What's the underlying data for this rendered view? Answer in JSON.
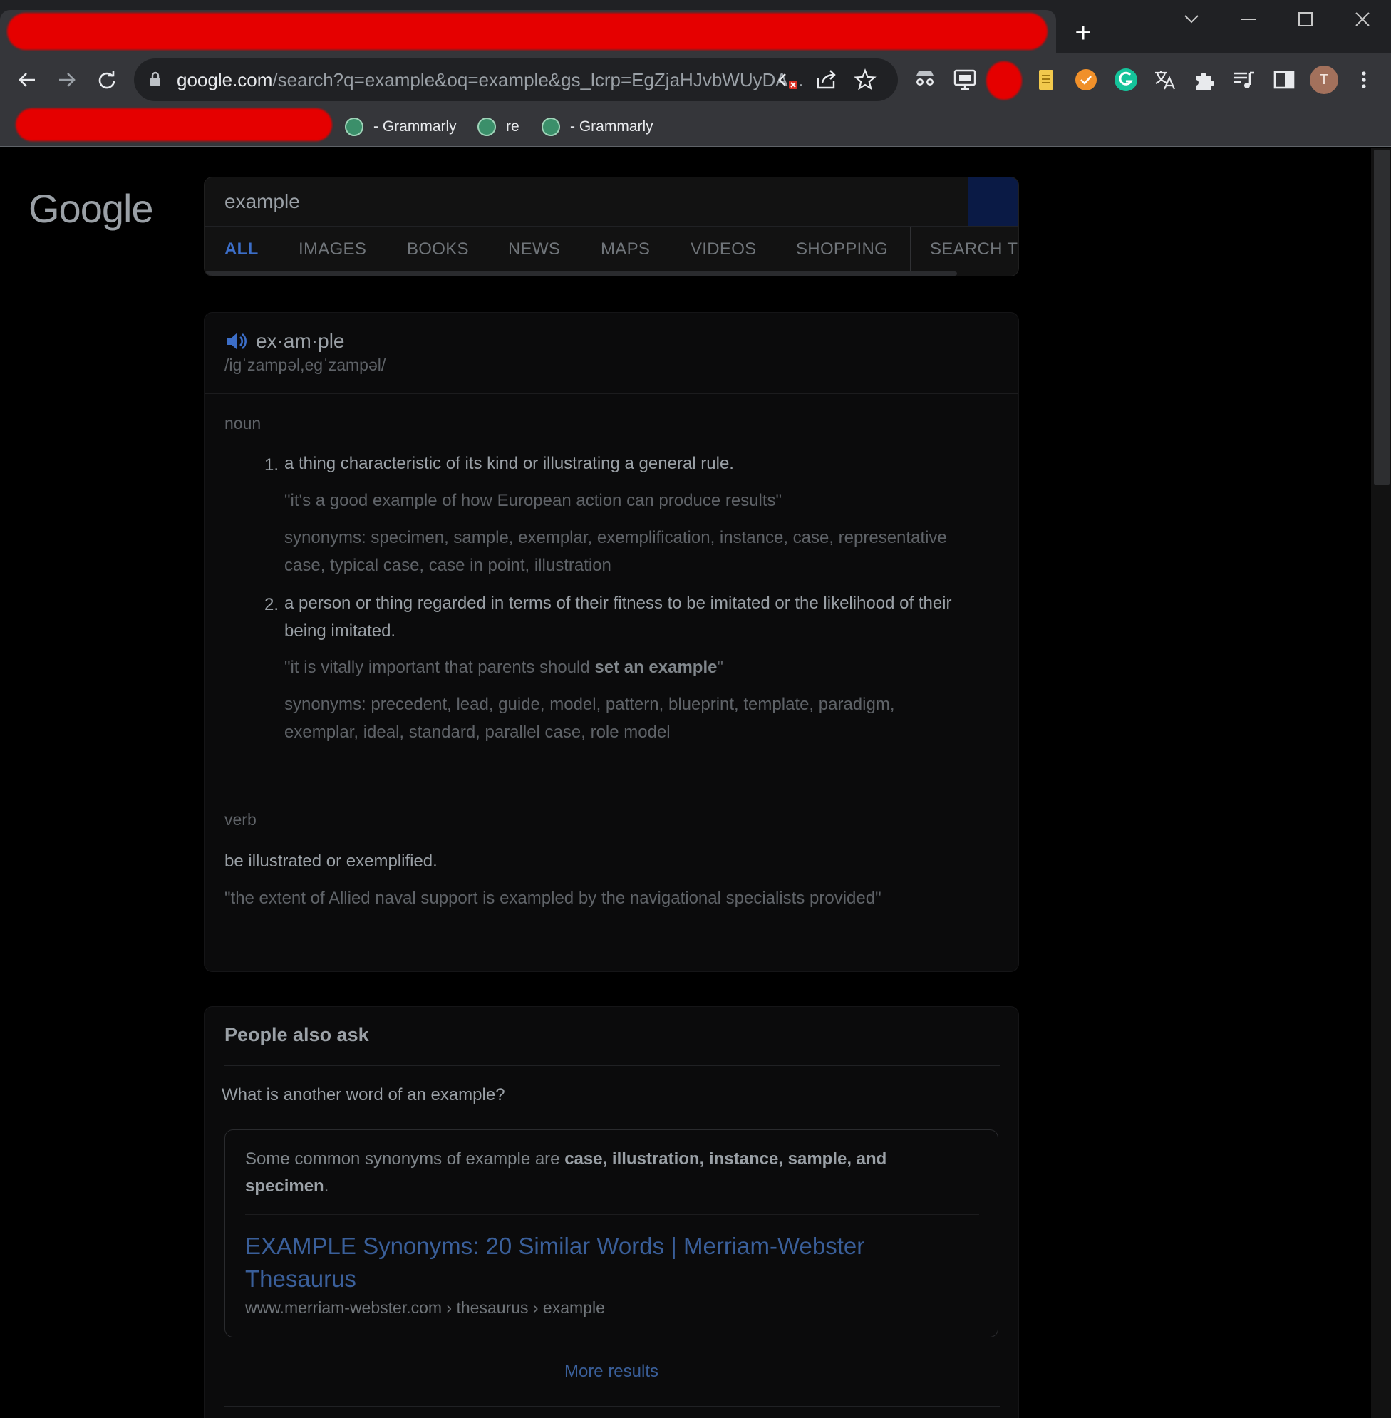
{
  "browser": {
    "new_tab_label": "+",
    "url_host": "google.com",
    "url_path": "/search?q=example&oq=example&gs_lcrp=EgZjaHJvbWUyDA...",
    "profile_initial": "T",
    "bookmarks": [
      {
        "label": "- Grammarly"
      },
      {
        "label": "re"
      },
      {
        "label": "- Grammarly"
      }
    ]
  },
  "google": {
    "logo_text": "Google",
    "query": "example",
    "tabs": [
      "ALL",
      "IMAGES",
      "BOOKS",
      "NEWS",
      "MAPS",
      "VIDEOS",
      "SHOPPING",
      "SEARCH T"
    ]
  },
  "dictionary": {
    "word": "ex·am·ple",
    "phonetic": "/iɡˈzampəl,eɡˈzampəl/",
    "noun_label": "noun",
    "defs": [
      {
        "num": "1.",
        "text": "a thing characteristic of its kind or illustrating a general rule.",
        "example": "\"it's a good example of how European action can produce results\"",
        "synonyms": "synonyms: specimen, sample, exemplar, exemplification, instance, case, representative case, typical case, case in point, illustration"
      },
      {
        "num": "2.",
        "text": "a person or thing regarded in terms of their fitness to be imitated or the likelihood of their being imitated.",
        "example_pre": "\"it is vitally important that parents should ",
        "example_bold": "set an example",
        "example_post": "\"",
        "synonyms": "synonyms: precedent, lead, guide, model, pattern, blueprint, template, paradigm, exemplar, ideal, standard, parallel case, role model"
      }
    ],
    "verb_label": "verb",
    "verb_def": "be illustrated or exemplified.",
    "verb_example": "\"the extent of Allied naval support is exampled by the navigational specialists provided\""
  },
  "paa": {
    "title": "People also ask",
    "question": "What is another word of an example?",
    "answer_pre": "Some common synonyms of example are ",
    "answer_bold1": "case, illustration, instance, sample, and",
    "answer_bold2": "specimen",
    "answer_post": ".",
    "link_title": "EXAMPLE Synonyms: 20 Similar Words | Merriam-Webster Thesaurus",
    "link_url": "www.merriam-webster.com › thesaurus › example",
    "more": "More results"
  },
  "colors": {
    "accent_link": "#3a5f9a",
    "active_tab": "#3c6ec8",
    "redaction": "#e50000"
  }
}
